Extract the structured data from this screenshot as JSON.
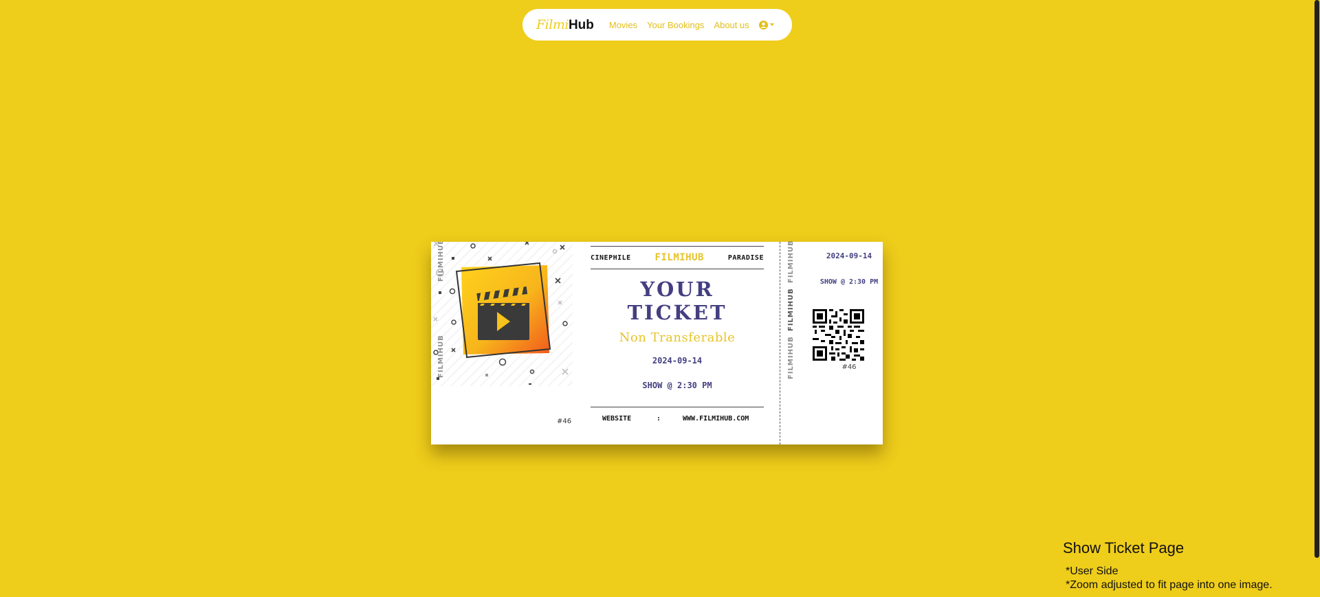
{
  "navbar": {
    "brand_part1": "Filmi",
    "brand_part2": "Hub",
    "links": [
      "Movies",
      "Your Bookings",
      "About us"
    ],
    "user_icon": "user-circle-icon"
  },
  "ticket": {
    "side_brand": "FILMIHUB",
    "cinema_left": "CINEPHILE",
    "brand": "FILMIHUB",
    "cinema_right": "PARADISE",
    "title": "YOUR TICKET",
    "subtitle": "Non Transferable",
    "date": "2024-09-14",
    "show": "SHOW @ 2:30 PM",
    "number": "#46",
    "website_label": "WEBSITE",
    "website_sep": ":",
    "website_value": "WWW.FILMIHUB.COM",
    "stub": {
      "date": "2024-09-14",
      "show": "SHOW @ 2:30 PM",
      "number": "#46",
      "brand": "FILMIHUB"
    }
  },
  "caption": {
    "title": "Show Ticket Page",
    "note1": "*User Side",
    "note2": "*Zoom adjusted to fit page into one image."
  },
  "colors": {
    "background": "#efcd1b",
    "accent": "#e7c429",
    "ticket_text": "#433f80"
  }
}
